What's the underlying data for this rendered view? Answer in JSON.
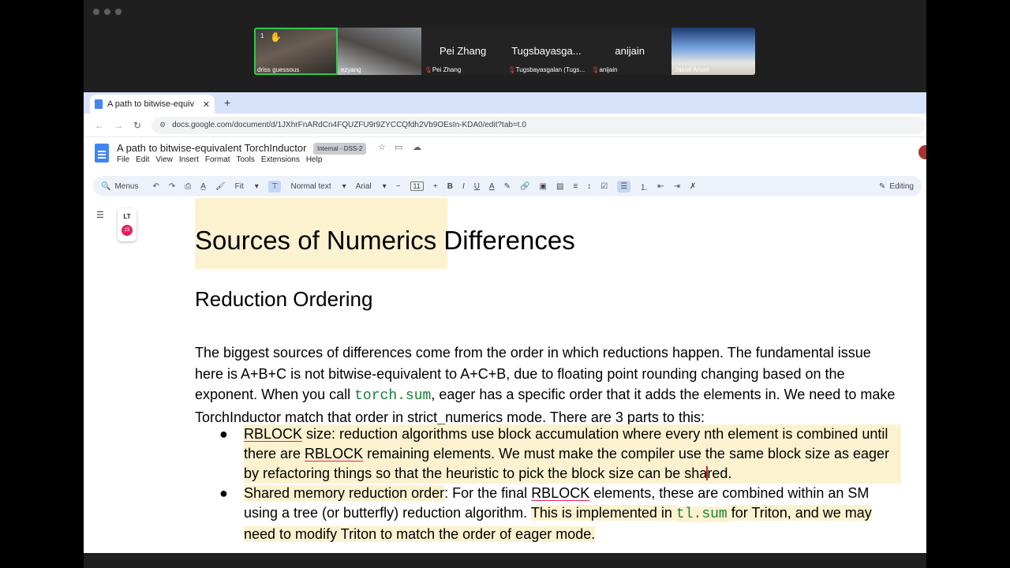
{
  "meeting": {
    "participants": [
      {
        "name": "driss guessous",
        "big": "",
        "hand": "✋",
        "count": "1",
        "active": true
      },
      {
        "name": "ezyang",
        "big": ""
      },
      {
        "name": "Pei Zhang",
        "big": "Pei Zhang"
      },
      {
        "name": "Tugsbayasgalan (Tugs...",
        "big": "Tugsbayasga..."
      },
      {
        "name": "anijain",
        "big": "anijain"
      },
      {
        "name": "Jason Ansel",
        "big": ""
      }
    ]
  },
  "browser": {
    "tab_title": "A path to bitwise-equiv",
    "url": "docs.google.com/document/d/1JXhrFnARdCn4FQUZFU9r9ZYCCQfdh2Vb9OEsIn-KDA0/edit?tab=t.0"
  },
  "docs": {
    "title": "A path to bitwise-equivalent TorchInductor",
    "label": "Internal - DSS-2",
    "menu": [
      "File",
      "Edit",
      "View",
      "Insert",
      "Format",
      "Tools",
      "Extensions",
      "Help"
    ],
    "toolbar": {
      "menus": "Menus",
      "zoom": "Fit",
      "style": "Normal text",
      "font": "Arial",
      "font_size": "11",
      "mode": "Editing"
    },
    "lt_badge": "23"
  },
  "content": {
    "h1_part1": "Sources of Numerics",
    "h1_part2": " Differences",
    "h2": "Reduction Ordering",
    "para_1": "The biggest sources of differences come from the order in which reductions happen. The fundamental issue here is A+B+C is not bitwise-equivalent to A+C+B, due to floating point rounding changing based on the exponent. When you call ",
    "para_code": "torch.sum",
    "para_2": ", eager has a specific order that it adds the elements in. We need to make TorchInductor match that order in strict_numerics mode. There are 3 parts to this:",
    "b1_term1": "RBLOCK",
    "b1_t1": " size: reduction algorithms use block accumulation where every nth element is combined until there are ",
    "b1_term2": "RBLOCK",
    "b1_t2": " remaining elements. We must make the compiler use the same block size as eager by refactoring things so that the heuristic to pick the block size can be sha",
    "b1_t3": "red.",
    "b2_t1": "Shared memory reduction order",
    "b2_t2": ": For the final ",
    "b2_term": "RBLOCK",
    "b2_t3": " elements, these are combined within an SM using a tree (or butterfly) reduction algorithm. ",
    "b2_t4": "This is implemented in ",
    "b2_code": "tl.sum",
    "b2_t5": " for Triton, and we may need to modify Triton to match the order of eager mode."
  }
}
